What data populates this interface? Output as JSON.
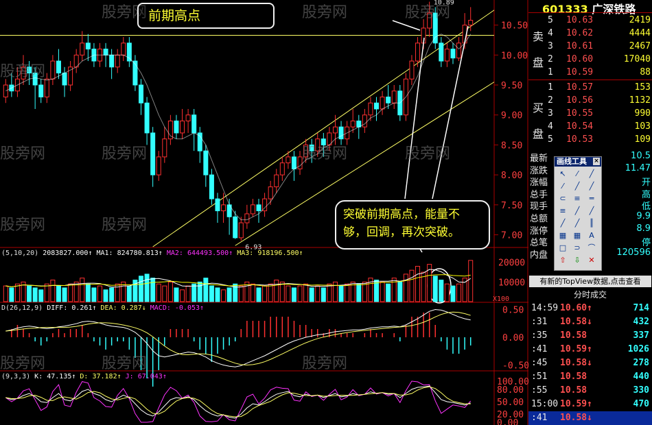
{
  "stock": {
    "code": "601333",
    "name": "广深铁路"
  },
  "watermark": "股旁网",
  "annotations": {
    "prev_high": "前期高点",
    "breakout_note": "突破前期高点，能量不够，回调，再次突破。",
    "low_label": "6.93",
    "high_label": "10.89"
  },
  "indicators": {
    "volume_legend": {
      "params": "(5,10,20)",
      "vol": "2083827.000↑",
      "ma1": "MA1: 824780.813↑",
      "ma2": "MA2: 644493.500↑",
      "ma3": "MA3: 918196.500↑"
    },
    "macd_legend": {
      "params": "D(26,12,9)",
      "diff": "DIFF: 0.261↑",
      "dea": "DEA: 0.287↓",
      "macd": "MACD: -0.053↑"
    },
    "kdj_legend": {
      "params": "(9,3,3)",
      "k": "K: 47.135↑",
      "d": "D: 37.182↑",
      "j": "J: 67.043↑"
    }
  },
  "sell_orders": [
    {
      "level": "5",
      "price": "10.63",
      "vol": "2419"
    },
    {
      "level": "4",
      "price": "10.62",
      "vol": "4444"
    },
    {
      "level": "3",
      "price": "10.61",
      "vol": "2467"
    },
    {
      "level": "2",
      "price": "10.60",
      "vol": "17040"
    },
    {
      "level": "1",
      "price": "10.59",
      "vol": "88"
    }
  ],
  "buy_orders": [
    {
      "level": "1",
      "price": "10.57",
      "vol": "153"
    },
    {
      "level": "2",
      "price": "10.56",
      "vol": "1132"
    },
    {
      "level": "3",
      "price": "10.55",
      "vol": "990"
    },
    {
      "level": "4",
      "price": "10.54",
      "vol": "103"
    },
    {
      "level": "5",
      "price": "10.53",
      "vol": "109"
    }
  ],
  "side_labels": {
    "sell_a": "卖",
    "sell_b": "盘",
    "buy_a": "买",
    "buy_b": "盘"
  },
  "info_rows": [
    {
      "k": "最新",
      "v": "10.5"
    },
    {
      "k": "涨跌",
      "v": "11.47"
    },
    {
      "k": "涨幅",
      "v": "开"
    },
    {
      "k": "总手",
      "v": "高"
    },
    {
      "k": "现手",
      "v": "低"
    },
    {
      "k": "总额",
      "v": "9.9"
    },
    {
      "k": "涨停",
      "v": "8.9"
    },
    {
      "k": "总笔",
      "v": "停"
    },
    {
      "k": "内盘",
      "v": "120596"
    }
  ],
  "toolbox": {
    "title": "画线工具",
    "close": "×",
    "tools": [
      "↖",
      "⁄",
      "╱",
      "⁄",
      "╱",
      "╱",
      "⊂",
      "≡",
      "═",
      "≡",
      "╱",
      "╱",
      "╱",
      "╱",
      "║",
      "▦",
      "▦",
      "A",
      "□",
      "⊃",
      "⌒",
      "⇧",
      "⇩",
      "✕"
    ]
  },
  "topview_banner": "有新的TopView数据,点击查看",
  "ticks_header": "分时成交",
  "ticks": [
    {
      "time": "14:59",
      "price": "10.60↑",
      "vol": "714"
    },
    {
      "time": ":31",
      "price": "10.58↓",
      "vol": "432"
    },
    {
      "time": ":35",
      "price": "10.58",
      "vol": "337"
    },
    {
      "time": ":41",
      "price": "10.59↑",
      "vol": "1026"
    },
    {
      "time": ":45",
      "price": "10.58↓",
      "vol": "278"
    },
    {
      "time": ":51",
      "price": "10.58",
      "vol": "440"
    },
    {
      "time": ":55",
      "price": "10.58",
      "vol": "330"
    },
    {
      "time": "15:00",
      "price": "10.59↑",
      "vol": "470"
    },
    {
      "time": ":41",
      "price": "10.58↓",
      "vol": ""
    }
  ],
  "axis_labels": {
    "price": [
      "10.50",
      "10.00",
      "9.50",
      "9.00",
      "8.50",
      "8.00",
      "7.50",
      "7.00"
    ],
    "volume": [
      "20000",
      "10000"
    ],
    "volume_unit": "X100",
    "macd": [
      "0.50",
      "0.00",
      "-0.50"
    ],
    "kdj": [
      "100.00",
      "80.00",
      "50.00",
      "20.00",
      "0.00"
    ]
  },
  "colors": {
    "up": "#ff3030",
    "down": "#33ffff",
    "ma1": "#ffffff",
    "ma2": "#ffff00",
    "ma3": "#ff33ff",
    "channel": "#ffff66"
  },
  "chart_data": {
    "type": "candlestick",
    "price_axis": {
      "min": 6.8,
      "max": 10.85
    },
    "prev_high": 10.33,
    "candles": [
      [
        9.3,
        9.5,
        9.2,
        9.6
      ],
      [
        9.5,
        9.4,
        9.3,
        9.7
      ],
      [
        9.4,
        9.6,
        9.3,
        9.8
      ],
      [
        9.6,
        9.8,
        9.5,
        10.0
      ],
      [
        9.8,
        9.7,
        9.5,
        9.9
      ],
      [
        9.7,
        9.5,
        9.1,
        9.8
      ],
      [
        9.5,
        9.3,
        9.2,
        9.6
      ],
      [
        9.3,
        9.6,
        9.2,
        9.7
      ],
      [
        9.6,
        9.9,
        9.5,
        10.0
      ],
      [
        9.9,
        9.7,
        9.6,
        10.1
      ],
      [
        9.7,
        9.5,
        9.3,
        9.8
      ],
      [
        9.5,
        9.8,
        9.4,
        9.9
      ],
      [
        9.8,
        10.0,
        9.7,
        10.1
      ],
      [
        10.0,
        10.2,
        9.9,
        10.4
      ],
      [
        10.2,
        10.1,
        9.9,
        10.35
      ],
      [
        10.1,
        9.9,
        9.8,
        10.2
      ],
      [
        9.9,
        10.1,
        9.8,
        10.2
      ],
      [
        10.1,
        10.0,
        9.8,
        10.2
      ],
      [
        10.0,
        9.8,
        9.6,
        10.1
      ],
      [
        9.8,
        10.0,
        9.7,
        10.1
      ],
      [
        10.0,
        10.2,
        9.9,
        10.3
      ],
      [
        10.2,
        9.9,
        9.8,
        10.3
      ],
      [
        9.9,
        9.5,
        9.4,
        10.0
      ],
      [
        9.5,
        9.2,
        9.0,
        9.6
      ],
      [
        9.2,
        8.7,
        8.5,
        9.3
      ],
      [
        8.7,
        8.0,
        7.8,
        8.8
      ],
      [
        8.0,
        8.3,
        7.9,
        8.4
      ],
      [
        8.3,
        8.6,
        8.2,
        8.8
      ],
      [
        8.6,
        8.9,
        8.5,
        9.0
      ],
      [
        8.9,
        8.7,
        8.6,
        9.0
      ],
      [
        8.7,
        8.9,
        8.6,
        9.1
      ],
      [
        8.9,
        9.0,
        8.7,
        9.1
      ],
      [
        9.0,
        8.7,
        8.4,
        9.1
      ],
      [
        8.7,
        8.4,
        8.2,
        8.8
      ],
      [
        8.4,
        8.0,
        7.8,
        8.5
      ],
      [
        8.0,
        7.6,
        7.5,
        8.1
      ],
      [
        7.6,
        7.4,
        7.2,
        7.7
      ],
      [
        7.4,
        7.5,
        7.2,
        7.7
      ],
      [
        7.5,
        7.3,
        7.0,
        7.6
      ],
      [
        7.3,
        6.95,
        6.93,
        7.4
      ],
      [
        6.95,
        7.2,
        6.9,
        7.3
      ],
      [
        7.2,
        7.35,
        7.1,
        7.5
      ],
      [
        7.35,
        7.5,
        7.3,
        7.6
      ],
      [
        7.5,
        7.4,
        7.2,
        7.6
      ],
      [
        7.4,
        7.6,
        7.3,
        7.7
      ],
      [
        7.6,
        7.8,
        7.5,
        7.9
      ],
      [
        7.8,
        8.0,
        7.7,
        8.1
      ],
      [
        8.0,
        8.2,
        7.9,
        8.3
      ],
      [
        8.2,
        8.3,
        8.1,
        8.4
      ],
      [
        8.3,
        8.1,
        7.9,
        8.4
      ],
      [
        8.1,
        8.3,
        8.0,
        8.4
      ],
      [
        8.3,
        8.5,
        8.2,
        8.6
      ],
      [
        8.5,
        8.4,
        8.2,
        8.6
      ],
      [
        8.4,
        8.6,
        8.3,
        8.7
      ],
      [
        8.6,
        8.5,
        8.3,
        8.7
      ],
      [
        8.5,
        8.7,
        8.4,
        8.8
      ],
      [
        8.7,
        8.8,
        8.5,
        9.0
      ],
      [
        8.8,
        8.6,
        8.5,
        8.9
      ],
      [
        8.6,
        8.8,
        8.5,
        8.9
      ],
      [
        8.8,
        8.9,
        8.7,
        9.1
      ],
      [
        8.9,
        8.8,
        8.6,
        9.0
      ],
      [
        8.8,
        9.0,
        8.7,
        9.1
      ],
      [
        9.0,
        9.2,
        8.9,
        9.3
      ],
      [
        9.2,
        9.1,
        8.9,
        9.3
      ],
      [
        9.1,
        9.3,
        9.0,
        9.4
      ],
      [
        9.3,
        9.2,
        9.1,
        9.5
      ],
      [
        9.2,
        9.4,
        9.1,
        9.5
      ],
      [
        9.4,
        9.0,
        8.9,
        9.5
      ],
      [
        9.0,
        9.6,
        8.9,
        9.7
      ],
      [
        9.6,
        9.9,
        9.5,
        10.0
      ],
      [
        9.9,
        10.2,
        9.8,
        10.3
      ],
      [
        10.2,
        10.45,
        10.1,
        10.6
      ],
      [
        10.45,
        10.7,
        10.3,
        10.89
      ],
      [
        10.7,
        10.2,
        10.1,
        10.8
      ],
      [
        10.2,
        9.9,
        9.8,
        10.3
      ],
      [
        9.9,
        10.1,
        9.8,
        10.2
      ],
      [
        10.1,
        9.95,
        9.85,
        10.2
      ],
      [
        9.95,
        10.2,
        9.9,
        10.3
      ],
      [
        10.2,
        10.5,
        10.1,
        10.7
      ],
      [
        10.5,
        10.58,
        10.4,
        10.8
      ]
    ],
    "volume": [
      8,
      7,
      9,
      10,
      8,
      7,
      6,
      9,
      11,
      8,
      7,
      9,
      10,
      12,
      9,
      7,
      8,
      6,
      7,
      9,
      10,
      8,
      11,
      13,
      14,
      12,
      9,
      8,
      10,
      7,
      6,
      8,
      9,
      10,
      12,
      8,
      7,
      6,
      7,
      9,
      8,
      10,
      9,
      7,
      8,
      9,
      11,
      10,
      8,
      7,
      8,
      9,
      7,
      8,
      7,
      9,
      10,
      8,
      9,
      10,
      9,
      10,
      12,
      11,
      10,
      9,
      12,
      10,
      14,
      16,
      18,
      15,
      19,
      13,
      11,
      9,
      8,
      9,
      12,
      21
    ],
    "ma1": [
      9.4,
      9.45,
      9.5,
      9.55,
      9.6,
      9.62,
      9.6,
      9.58,
      9.6,
      9.65,
      9.7,
      9.75,
      9.8,
      9.9,
      9.95,
      10.0,
      10.0,
      10.0,
      10.0,
      10.0,
      10.0,
      9.95,
      9.85,
      9.7,
      9.5,
      9.25,
      9.0,
      8.8,
      8.65,
      8.6,
      8.6,
      8.65,
      8.7,
      8.65,
      8.5,
      8.25,
      8.0,
      7.75,
      7.5,
      7.35,
      7.25,
      7.25,
      7.3,
      7.35,
      7.45,
      7.55,
      7.7,
      7.85,
      8.0,
      8.1,
      8.15,
      8.25,
      8.3,
      8.35,
      8.45,
      8.5,
      8.6,
      8.65,
      8.7,
      8.75,
      8.8,
      8.85,
      8.95,
      9.0,
      9.1,
      9.15,
      9.2,
      9.2,
      9.3,
      9.45,
      9.65,
      9.9,
      10.15,
      10.3,
      10.35,
      10.3,
      10.2,
      10.1,
      10.2,
      10.35
    ],
    "macd": [
      0.1,
      0.12,
      0.15,
      0.17,
      0.18,
      0.17,
      0.15,
      0.14,
      0.15,
      0.17,
      0.18,
      0.2,
      0.22,
      0.25,
      0.26,
      0.25,
      0.23,
      0.2,
      0.18,
      0.17,
      0.16,
      0.13,
      0.08,
      0.0,
      -0.1,
      -0.22,
      -0.3,
      -0.32,
      -0.3,
      -0.28,
      -0.26,
      -0.24,
      -0.25,
      -0.28,
      -0.32,
      -0.38,
      -0.42,
      -0.45,
      -0.47,
      -0.48,
      -0.46,
      -0.42,
      -0.38,
      -0.34,
      -0.3,
      -0.25,
      -0.2,
      -0.15,
      -0.1,
      -0.06,
      -0.03,
      0.0,
      0.02,
      0.04,
      0.05,
      0.07,
      0.09,
      0.1,
      0.11,
      0.12,
      0.12,
      0.13,
      0.15,
      0.16,
      0.17,
      0.17,
      0.18,
      0.17,
      0.2,
      0.25,
      0.3,
      0.36,
      0.42,
      0.45,
      0.44,
      0.41,
      0.37,
      0.33,
      0.3,
      0.28
    ],
    "kdj_k": [
      60,
      55,
      58,
      65,
      70,
      62,
      50,
      48,
      60,
      70,
      55,
      52,
      62,
      75,
      80,
      70,
      65,
      55,
      50,
      58,
      66,
      60,
      45,
      30,
      20,
      15,
      25,
      40,
      55,
      60,
      58,
      62,
      55,
      40,
      28,
      20,
      15,
      18,
      12,
      10,
      20,
      35,
      45,
      42,
      50,
      60,
      68,
      72,
      75,
      65,
      62,
      68,
      64,
      66,
      60,
      65,
      70,
      62,
      64,
      70,
      66,
      68,
      74,
      70,
      72,
      68,
      70,
      60,
      70,
      80,
      85,
      86,
      88,
      72,
      55,
      50,
      48,
      45,
      42,
      47
    ]
  }
}
